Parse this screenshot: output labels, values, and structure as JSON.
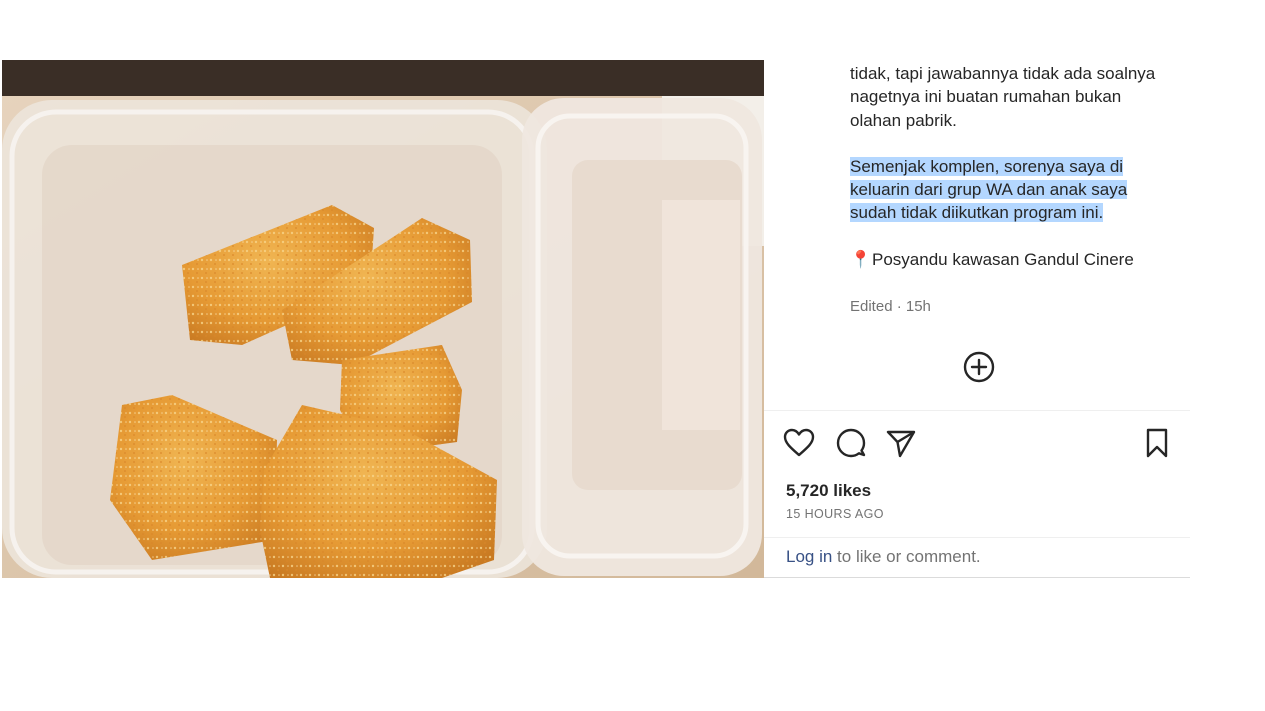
{
  "caption": {
    "line_top": "tidak, tapi jawabannya tidak ada soalnya nagetnya ini buatan rumahan bukan olahan pabrik.",
    "highlighted": [
      "Semenjak komplen, sorenya saya di",
      "keluarin dari grup WA dan anak saya",
      "sudah tidak diikutkan program ini."
    ],
    "location_pin": "📍",
    "location": "Posyandu kawasan Gandul Cinere"
  },
  "meta": {
    "edited": "Edited · 15h"
  },
  "icons": {
    "add": "plus-circle-icon",
    "like": "heart-icon",
    "comment": "comment-icon",
    "share": "paper-plane-icon",
    "save": "bookmark-icon"
  },
  "stats": {
    "likes": "5,720 likes",
    "time": "15 HOURS AGO"
  },
  "login": {
    "link": "Log in",
    "rest": " to like or comment."
  },
  "colors": {
    "highlight": "#b4d7ff",
    "link": "#385185",
    "muted": "#737373",
    "text": "#262626"
  }
}
